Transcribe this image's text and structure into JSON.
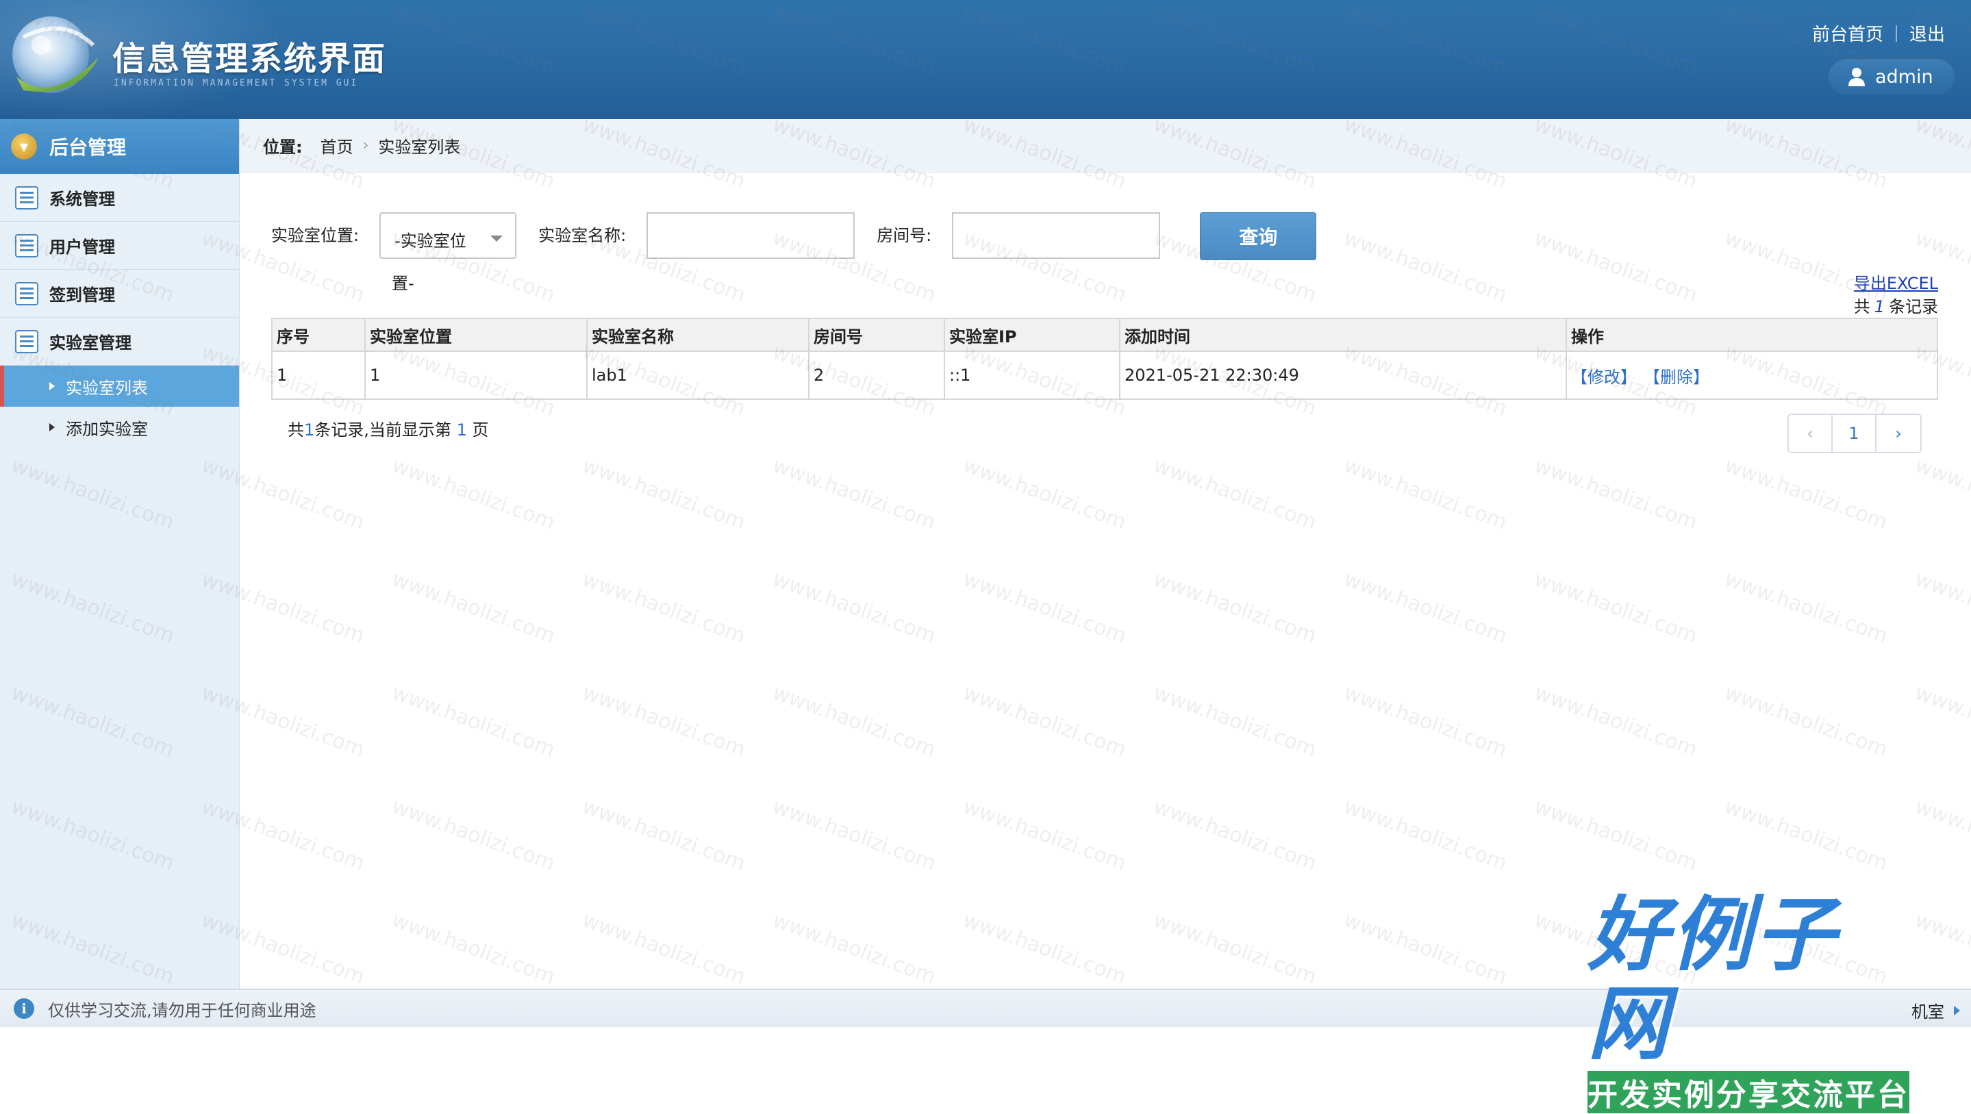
{
  "header": {
    "title": "信息管理系统界面",
    "subtitle": "INFORMATION MANAGEMENT SYSTEM GUI",
    "links": [
      "前台首页",
      "退出"
    ],
    "user": "admin"
  },
  "sidebar": {
    "heading": "后台管理",
    "items": [
      {
        "label": "系统管理"
      },
      {
        "label": "用户管理"
      },
      {
        "label": "签到管理"
      },
      {
        "label": "实验室管理"
      }
    ],
    "subitems": [
      {
        "label": "实验室列表",
        "active": true
      },
      {
        "label": "添加实验室",
        "active": false
      }
    ]
  },
  "breadcrumb": {
    "label": "位置:",
    "home": "首页",
    "current": "实验室列表"
  },
  "search": {
    "location_label": "实验室位置:",
    "location_value": "-实验室位置-",
    "location_value_line1": "-实验室位",
    "location_value_line2": "置-",
    "name_label": "实验室名称:",
    "name_value": "",
    "room_label": "房间号:",
    "room_value": "",
    "query_button": "查询"
  },
  "toolbar": {
    "export_label": "导出EXCEL",
    "total_prefix": "共",
    "total_count": "1",
    "total_suffix": "条记录"
  },
  "table": {
    "columns": [
      "序号",
      "实验室位置",
      "实验室名称",
      "房间号",
      "实验室IP",
      "添加时间",
      "操作"
    ],
    "rows": [
      {
        "no": "1",
        "location": "1",
        "name": "lab1",
        "room": "2",
        "ip": "::1",
        "added": "2021-05-21 22:30:49",
        "edit": "【修改】",
        "delete": "【删除】"
      }
    ]
  },
  "pager": {
    "info_prefix": "共",
    "info_count": "1",
    "info_mid": "条记录,当前显示第",
    "info_page": "1",
    "info_suffix": "页",
    "prev": "‹",
    "current": "1",
    "next": "›"
  },
  "footer": {
    "notice": "仅供学习交流,请勿用于任何商业用途",
    "right_text": "机室"
  },
  "watermark": {
    "text": "www.haolizi.com",
    "brand_main": "好例子网",
    "brand_sub": "开发实例分享交流平台"
  },
  "colors": {
    "header_blue": "#2a6aa4",
    "sidebar_active": "#5aa6dd",
    "link_blue": "#2a6fc9",
    "button_blue": "#4a8bc4"
  }
}
